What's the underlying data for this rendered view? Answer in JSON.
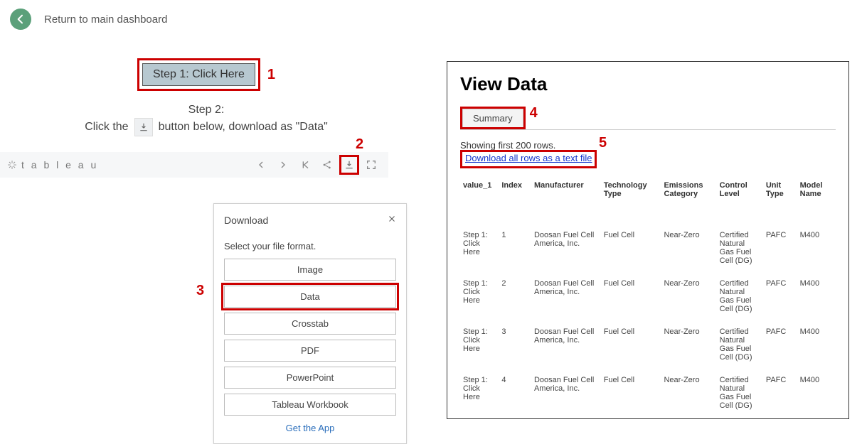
{
  "nav": {
    "return_text": "Return to main dashboard"
  },
  "steps": {
    "step1_label": "Step 1: Click Here",
    "step2_line1": "Step 2:",
    "step2_prefix": "Click the",
    "step2_suffix": "button below, download as \"Data\""
  },
  "annotations": {
    "a1": "1",
    "a2": "2",
    "a3": "3",
    "a4": "4",
    "a5": "5"
  },
  "tableau_bar": {
    "logo_text": "t a b l e a u"
  },
  "download_popup": {
    "title": "Download",
    "subtitle": "Select your file format.",
    "options": [
      "Image",
      "Data",
      "Crosstab",
      "PDF",
      "PowerPoint",
      "Tableau Workbook"
    ],
    "get_app": "Get the App"
  },
  "view_data": {
    "title": "View Data",
    "tab": "Summary",
    "rows_text": "Showing first 200 rows.",
    "download_link": "Download all rows as a text file",
    "columns": [
      "value_1",
      "Index",
      "Manufacturer",
      "Technology Type",
      "Emissions Category",
      "Control Level",
      "Unit Type",
      "Model Name"
    ],
    "rows": [
      {
        "value_1": "Step 1: Click Here",
        "index": "1",
        "manufacturer": "Doosan Fuel Cell America, Inc.",
        "tech": "Fuel Cell",
        "emissions": "Near-Zero",
        "control": "Certified Natural Gas Fuel Cell (DG)",
        "unit": "PAFC",
        "model": "M400"
      },
      {
        "value_1": "Step 1: Click Here",
        "index": "2",
        "manufacturer": "Doosan Fuel Cell America, Inc.",
        "tech": "Fuel Cell",
        "emissions": "Near-Zero",
        "control": "Certified Natural Gas Fuel Cell (DG)",
        "unit": "PAFC",
        "model": "M400"
      },
      {
        "value_1": "Step 1: Click Here",
        "index": "3",
        "manufacturer": "Doosan Fuel Cell America, Inc.",
        "tech": "Fuel Cell",
        "emissions": "Near-Zero",
        "control": "Certified Natural Gas Fuel Cell (DG)",
        "unit": "PAFC",
        "model": "M400"
      },
      {
        "value_1": "Step 1: Click Here",
        "index": "4",
        "manufacturer": "Doosan Fuel Cell America, Inc.",
        "tech": "Fuel Cell",
        "emissions": "Near-Zero",
        "control": "Certified Natural Gas Fuel Cell (DG)",
        "unit": "PAFC",
        "model": "M400"
      }
    ]
  }
}
